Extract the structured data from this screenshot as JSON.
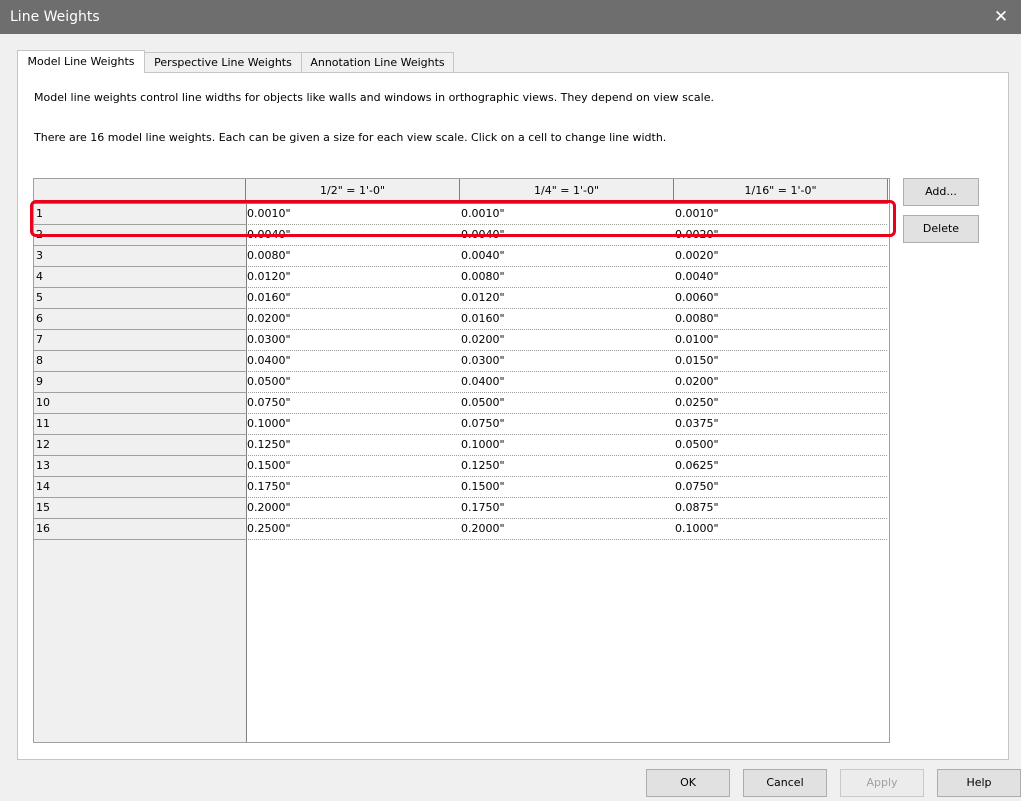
{
  "window": {
    "title": "Line Weights",
    "close_glyph": "✕"
  },
  "tabs": [
    {
      "label": "Model Line Weights",
      "active": true
    },
    {
      "label": "Perspective Line Weights",
      "active": false
    },
    {
      "label": "Annotation Line Weights",
      "active": false
    }
  ],
  "description": {
    "line1": "Model line weights control line widths for objects like walls and windows in orthographic views. They depend on view scale.",
    "line2": "There are 16 model line weights. Each can be given a size for each view scale. Click on a cell to change line width."
  },
  "table": {
    "columns": [
      "1/2\" = 1'-0\"",
      "1/4\" = 1'-0\"",
      "1/16\" = 1'-0\""
    ],
    "rows": [
      {
        "weight": "1",
        "values": [
          "0.0010\"",
          "0.0010\"",
          "0.0010\""
        ]
      },
      {
        "weight": "2",
        "values": [
          "0.0040\"",
          "0.0040\"",
          "0.0020\""
        ]
      },
      {
        "weight": "3",
        "values": [
          "0.0080\"",
          "0.0040\"",
          "0.0020\""
        ]
      },
      {
        "weight": "4",
        "values": [
          "0.0120\"",
          "0.0080\"",
          "0.0040\""
        ]
      },
      {
        "weight": "5",
        "values": [
          "0.0160\"",
          "0.0120\"",
          "0.0060\""
        ]
      },
      {
        "weight": "6",
        "values": [
          "0.0200\"",
          "0.0160\"",
          "0.0080\""
        ]
      },
      {
        "weight": "7",
        "values": [
          "0.0300\"",
          "0.0200\"",
          "0.0100\""
        ]
      },
      {
        "weight": "8",
        "values": [
          "0.0400\"",
          "0.0300\"",
          "0.0150\""
        ]
      },
      {
        "weight": "9",
        "values": [
          "0.0500\"",
          "0.0400\"",
          "0.0200\""
        ]
      },
      {
        "weight": "10",
        "values": [
          "0.0750\"",
          "0.0500\"",
          "0.0250\""
        ]
      },
      {
        "weight": "11",
        "values": [
          "0.1000\"",
          "0.0750\"",
          "0.0375\""
        ]
      },
      {
        "weight": "12",
        "values": [
          "0.1250\"",
          "0.1000\"",
          "0.0500\""
        ]
      },
      {
        "weight": "13",
        "values": [
          "0.1500\"",
          "0.1250\"",
          "0.0625\""
        ]
      },
      {
        "weight": "14",
        "values": [
          "0.1750\"",
          "0.1500\"",
          "0.0750\""
        ]
      },
      {
        "weight": "15",
        "values": [
          "0.2000\"",
          "0.1750\"",
          "0.0875\""
        ]
      },
      {
        "weight": "16",
        "values": [
          "0.2500\"",
          "0.2000\"",
          "0.1000\""
        ]
      }
    ],
    "highlighted_row": "1"
  },
  "side_buttons": {
    "add": "Add...",
    "delete": "Delete"
  },
  "footer_buttons": {
    "ok": "OK",
    "cancel": "Cancel",
    "apply": "Apply",
    "help": "Help"
  },
  "colors": {
    "highlight": "#e8001c",
    "titlebar": "#6e6e6e"
  }
}
